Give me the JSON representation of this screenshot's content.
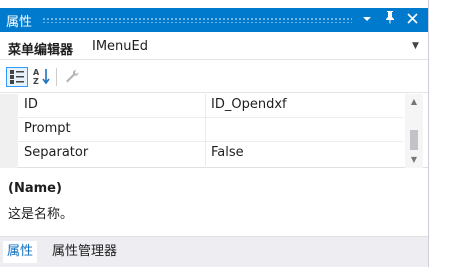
{
  "window": {
    "title": "属性"
  },
  "object_selector": {
    "name": "菜单编辑器",
    "type": "IMenuEd"
  },
  "toolbar": {
    "items": [
      {
        "icon": "categorized-icon",
        "active": true
      },
      {
        "icon": "alphabetical-sort-icon",
        "active": false
      },
      {
        "icon": "property-pages-wrench-icon",
        "active": false
      }
    ]
  },
  "properties": [
    {
      "name": "ID",
      "value": "ID_Opendxf"
    },
    {
      "name": "Prompt",
      "value": ""
    },
    {
      "name": "Separator",
      "value": "False"
    }
  ],
  "description": {
    "title": "(Name)",
    "text": "这是名称。"
  },
  "tabs": [
    {
      "label": "属性",
      "active": true
    },
    {
      "label": "属性管理器",
      "active": false
    }
  ],
  "colors": {
    "titlebar": "#007acc",
    "active_tab_text": "#0e70c0"
  }
}
